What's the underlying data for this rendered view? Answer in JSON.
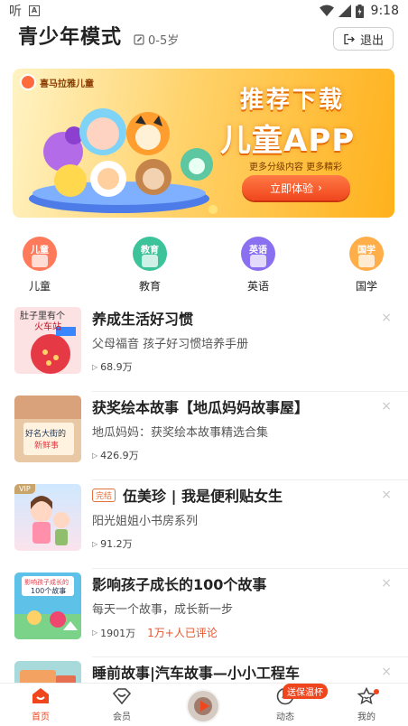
{
  "status_bar": {
    "time": "9:18",
    "left_glyph": "听",
    "left_badge": "A"
  },
  "header": {
    "title": "青少年模式",
    "age_range": "0-5岁",
    "exit_label": "退出"
  },
  "banner": {
    "brand": "喜马拉雅儿童",
    "headline_line1": "推荐下载",
    "headline_line2": "儿童APP",
    "subline": "更多分级内容 更多精彩",
    "cta_label": "立即体验",
    "cta_arrow": "›"
  },
  "categories": [
    {
      "icon_text": "儿童",
      "label": "儿童",
      "color": "#ff7a5a"
    },
    {
      "icon_text": "教育",
      "label": "教育",
      "color": "#3cc39a"
    },
    {
      "icon_text": "英语",
      "label": "英语",
      "color": "#8a6ff0"
    },
    {
      "icon_text": "国学",
      "label": "国学",
      "color": "#ffae4a"
    }
  ],
  "list": [
    {
      "title": "养成生活好习惯",
      "subtitle": "父母福音 孩子好习惯培养手册",
      "plays": "68.9万",
      "comments": "",
      "tag": "",
      "vip": false
    },
    {
      "title": "获奖绘本故事【地瓜妈妈故事屋】",
      "subtitle": "地瓜妈妈：获奖绘本故事精选合集",
      "plays": "426.9万",
      "comments": "",
      "tag": "",
      "vip": false
    },
    {
      "title": "伍美珍 | 我是便利贴女生",
      "subtitle": "阳光姐姐小书房系列",
      "plays": "91.2万",
      "comments": "",
      "tag": "完结",
      "vip": true
    },
    {
      "title": "影响孩子成长的100个故事",
      "subtitle": "每天一个故事，成长新一步",
      "plays": "1901万",
      "comments": "1万+人已评论",
      "tag": "",
      "vip": false
    },
    {
      "title": "睡前故事|汽车故事—小小工程车",
      "subtitle": "",
      "plays": "",
      "comments": "",
      "tag": "",
      "vip": false
    }
  ],
  "list_close_glyph": "×",
  "list_play_glyph": "▷",
  "covers": {
    "cover1_text1": "肚子里有个",
    "cover1_text2": "火车站",
    "cover2_text1": "好名大街的",
    "cover2_text2": "新鲜事",
    "cover4_text1": "影响孩子成长的",
    "cover4_text2": "100个故事",
    "vip_label": "VIP"
  },
  "tab_bar": {
    "tabs": [
      {
        "label": "首页",
        "active": true
      },
      {
        "label": "会员",
        "active": false
      },
      {
        "label": "动态",
        "active": false
      },
      {
        "label": "我的",
        "active": false
      }
    ],
    "badge": "送保温杯"
  },
  "colors": {
    "accent": "#f0461e",
    "tag": "#e4703a",
    "banner_start": "#fff3c4",
    "banner_end": "#ffb11c"
  }
}
